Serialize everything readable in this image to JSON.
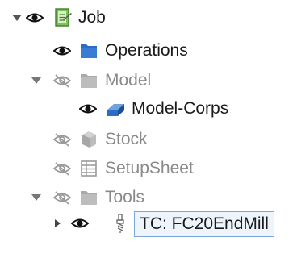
{
  "tree": {
    "job": {
      "label": "Job",
      "expanded": true,
      "visible": true,
      "icon": "job-sheet-icon"
    },
    "operations": {
      "label": "Operations",
      "visible": true,
      "icon": "folder-icon"
    },
    "model": {
      "label": "Model",
      "expanded": true,
      "visible": false,
      "icon": "folder-icon"
    },
    "model_corps": {
      "label": "Model-Corps",
      "visible": true,
      "icon": "solid-body-icon"
    },
    "stock": {
      "label": "Stock",
      "visible": false,
      "icon": "stock-cube-icon"
    },
    "setup_sheet": {
      "label": "SetupSheet",
      "visible": false,
      "icon": "spreadsheet-icon"
    },
    "tools": {
      "label": "Tools",
      "expanded": true,
      "visible": false,
      "icon": "folder-icon"
    },
    "tool_controller": {
      "label": "TC: FC20EndMill",
      "expanded": false,
      "visible": true,
      "selected": true,
      "icon": "endmill-icon"
    }
  },
  "colors": {
    "eye_visible": "#111111",
    "eye_hidden": "#9a9a9a",
    "folder_blue": "#2b6cc4",
    "folder_grey": "#b0b0b0",
    "selection_border": "#7aa7d8",
    "selection_fill": "#eef4fb",
    "label_active": "#1a1a1a",
    "label_dim": "#8a8a8a"
  }
}
